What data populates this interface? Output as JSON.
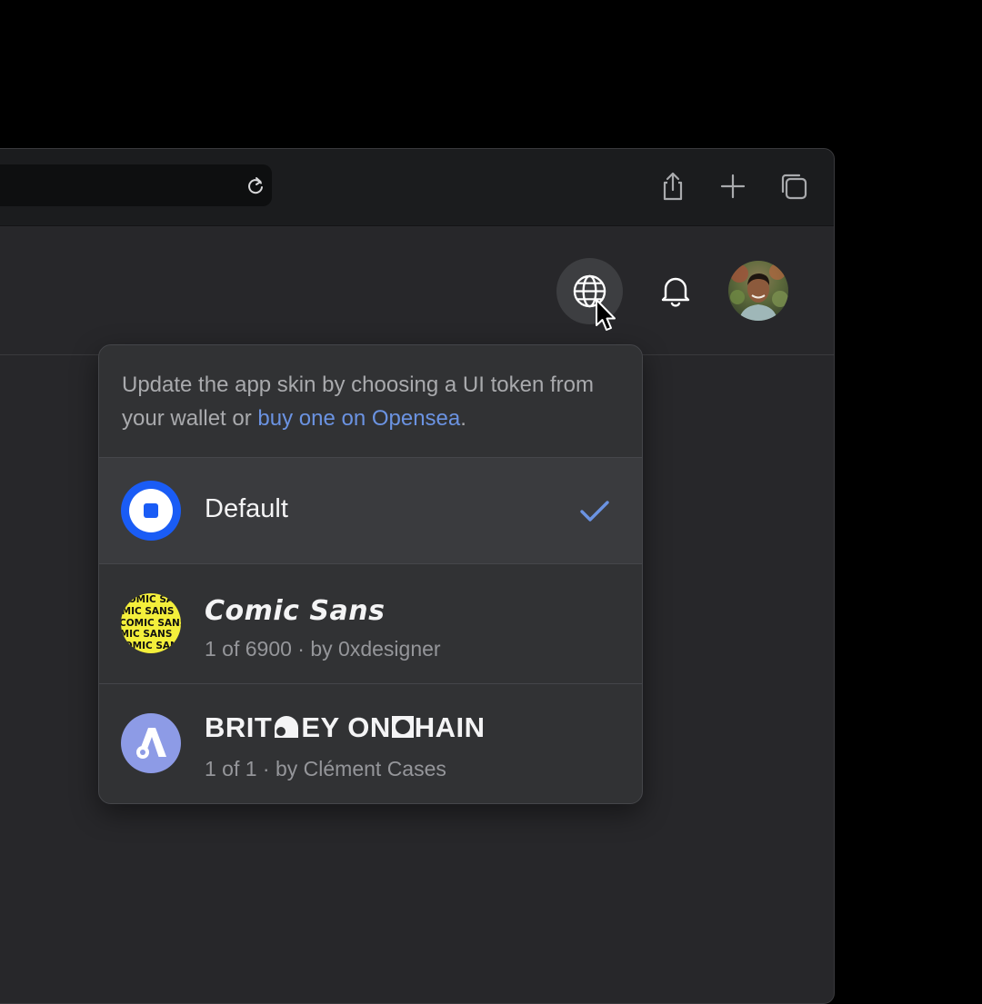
{
  "browser": {
    "toolbar_icons": [
      "reload-icon",
      "share-icon",
      "new-tab-plus-icon",
      "tabs-icon"
    ]
  },
  "header": {
    "icons": [
      "globe-icon",
      "bell-icon",
      "user-avatar"
    ]
  },
  "skin_menu": {
    "intro_text": "Update the app skin by choosing a UI token from your wallet or ",
    "intro_link": "buy one on Opensea",
    "intro_end": ".",
    "options": [
      {
        "title": "Default",
        "subtitle": "",
        "selected": true,
        "icon": "default-token-icon"
      },
      {
        "title": "Comic Sans",
        "subtitle": "1 of 6900 · by 0xdesigner",
        "selected": false,
        "icon": "comic-sans-token-icon",
        "icon_text": "COMIC SANS"
      },
      {
        "title_left": "BRIT",
        "title_mid": "EY ON",
        "title_right": "HAIN",
        "subtitle": "1 of 1 · by Clément Cases",
        "selected": false,
        "icon": "britney-onchain-token-icon"
      }
    ]
  },
  "colors": {
    "accent_blue": "#6b93e2",
    "default_token_blue": "#1a5cf5",
    "comic_yellow": "#f4ef3b",
    "britney_purple": "#8d9be6"
  }
}
